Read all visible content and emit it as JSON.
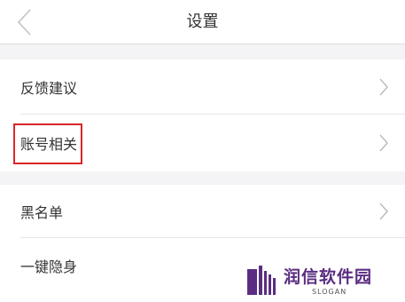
{
  "header": {
    "title": "设置"
  },
  "menu": {
    "items": [
      {
        "label": "反馈建议"
      },
      {
        "label": "账号相关"
      },
      {
        "label": "黑名单"
      },
      {
        "label": "一键隐身"
      }
    ]
  },
  "icons": {
    "back": "chevron-left-icon",
    "row_arrow": "chevron-right-icon"
  },
  "colors": {
    "highlight": "#d9262a",
    "watermark": "#5a2d82",
    "separator": "#f4f4f6"
  },
  "watermark": {
    "text": "润信软件园",
    "slogan": "SLOGAN"
  }
}
